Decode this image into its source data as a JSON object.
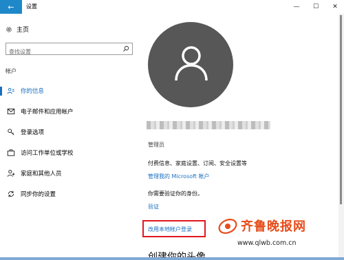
{
  "window": {
    "title": "设置",
    "back_icon": "arrow-left-icon",
    "controls": {
      "minimize": "—",
      "maximize": "☐",
      "close": "✕"
    }
  },
  "sidebar": {
    "home_label": "主页",
    "search_placeholder": "查找设置",
    "section_label": "帐户",
    "items": [
      {
        "label": "你的信息",
        "icon": "person-card-icon",
        "active": true
      },
      {
        "label": "电子邮件和应用帐户",
        "icon": "mail-icon",
        "active": false
      },
      {
        "label": "登录选项",
        "icon": "key-icon",
        "active": false
      },
      {
        "label": "访问工作单位或学校",
        "icon": "briefcase-icon",
        "active": false
      },
      {
        "label": "家庭和其他人员",
        "icon": "person-add-icon",
        "active": false
      },
      {
        "label": "同步你的设置",
        "icon": "sync-icon",
        "active": false
      }
    ]
  },
  "main": {
    "role": "管理员",
    "features_text": "付费信息、家庭设置、订阅、安全设置等",
    "manage_link": "管理我的 Microsoft 帐户",
    "verify_text": "你需要验证你的身份。",
    "verify_link": "验证",
    "local_account_link": "改用本地帐户登录",
    "create_avatar_title": "创建你的头像"
  },
  "watermark": {
    "brand": "齐鲁晚报网",
    "url": "www.qlwb.com.cn"
  },
  "colors": {
    "accent": "#1a6fc2",
    "back_button": "#1e88c8",
    "highlight_box": "#e0161d",
    "avatar_bg": "#575757",
    "watermark": "#e64c1a"
  }
}
